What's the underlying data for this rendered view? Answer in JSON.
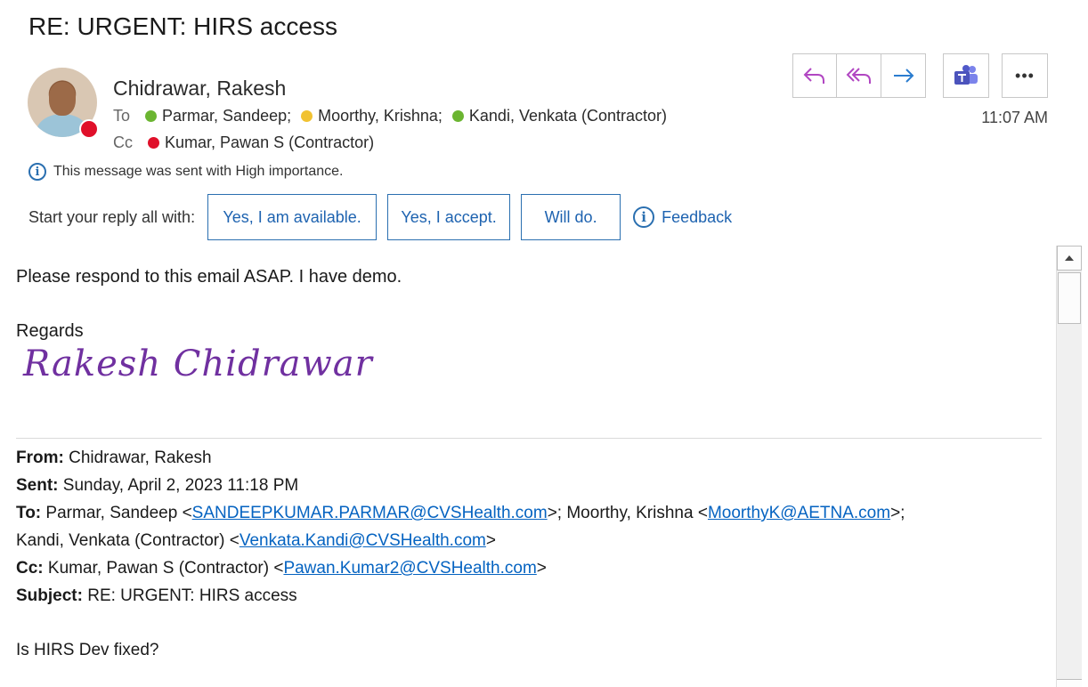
{
  "email": {
    "subject": "RE: URGENT: HIRS access",
    "sender": "Chidrawar, Rakesh",
    "time": "11:07 AM",
    "to_label": "To",
    "cc_label": "Cc",
    "to": [
      {
        "name": "Parmar, Sandeep",
        "sep": ";",
        "status": "available"
      },
      {
        "name": "Moorthy, Krishna",
        "sep": ";",
        "status": "away"
      },
      {
        "name": "Kandi, Venkata (Contractor)",
        "sep": "",
        "status": "available"
      }
    ],
    "cc": [
      {
        "name": "Kumar, Pawan S (Contractor)",
        "status": "busy"
      }
    ],
    "importance_note": "This message was sent with High importance."
  },
  "actions": {
    "reply_icon": "reply-icon",
    "reply_all_icon": "reply-all-icon",
    "forward_icon": "forward-icon",
    "teams_icon": "teams-icon",
    "more_label": "•••"
  },
  "quick_reply": {
    "prompt": "Start your reply all with:",
    "options": [
      "Yes, I am available.",
      "Yes, I accept.",
      "Will do."
    ],
    "feedback": "Feedback"
  },
  "body": {
    "line1": "Please respond to this email ASAP. I have demo.",
    "regards": "Regards",
    "signature": "Rakesh Chidrawar"
  },
  "quoted": {
    "from_label": "From:",
    "from": "Chidrawar, Rakesh",
    "sent_label": "Sent:",
    "sent": "Sunday, April 2, 2023 11:18 PM",
    "to_label": "To:",
    "to_name1": "Parmar, Sandeep <",
    "to_email1": "SANDEEPKUMAR.PARMAR@CVSHealth.com",
    "to_mid": ">; Moorthy, Krishna <",
    "to_email2": "MoorthyK@AETNA.com",
    "to_end": ">;",
    "to_name3": "Kandi, Venkata (Contractor) <",
    "to_email3": "Venkata.Kandi@CVSHealth.com",
    "to_close3": ">",
    "cc_label": "Cc:",
    "cc_name": "Kumar, Pawan S (Contractor) <",
    "cc_email": "Pawan.Kumar2@CVSHealth.com",
    "cc_close": ">",
    "subject_label": "Subject:",
    "subject": "RE: URGENT: HIRS access",
    "body": "Is HIRS Dev fixed?"
  },
  "colors": {
    "accent_blue": "#1e63b0",
    "link": "#0563c1",
    "status_available": "#6bb531",
    "status_away": "#f1c232",
    "status_busy": "#e0102a",
    "signature": "#7030a0",
    "action_icon_purple": "#b146c2"
  }
}
